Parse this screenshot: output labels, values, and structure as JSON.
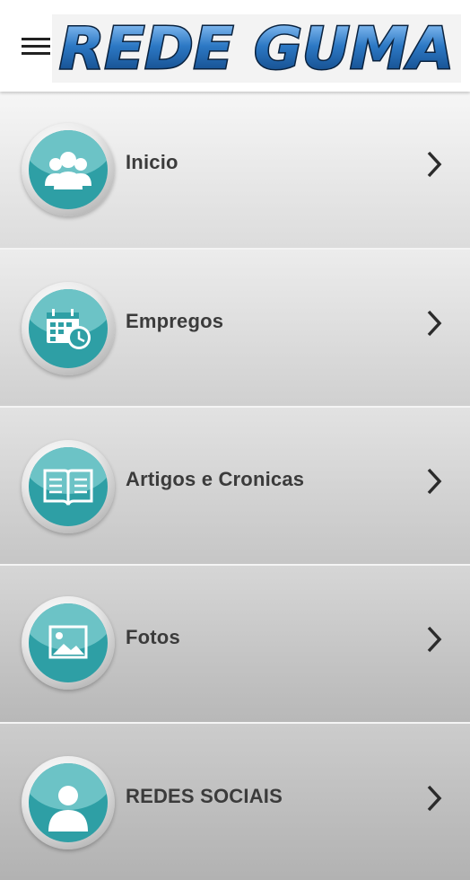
{
  "header": {
    "title": "REDE GUMA",
    "menu_icon": "hamburger-menu-icon",
    "logo_color": "#2a6fb0"
  },
  "menu": {
    "items": [
      {
        "label": "Inicio",
        "icon": "users-group-icon"
      },
      {
        "label": "Empregos",
        "icon": "calendar-clock-icon"
      },
      {
        "label": "Artigos e Cronicas",
        "icon": "open-book-icon"
      },
      {
        "label": "Fotos",
        "icon": "picture-icon"
      },
      {
        "label": "REDES SOCIAIS",
        "icon": "person-icon"
      }
    ],
    "chevron_icon": "chevron-right-icon",
    "icon_color": "#2e9fa5"
  }
}
